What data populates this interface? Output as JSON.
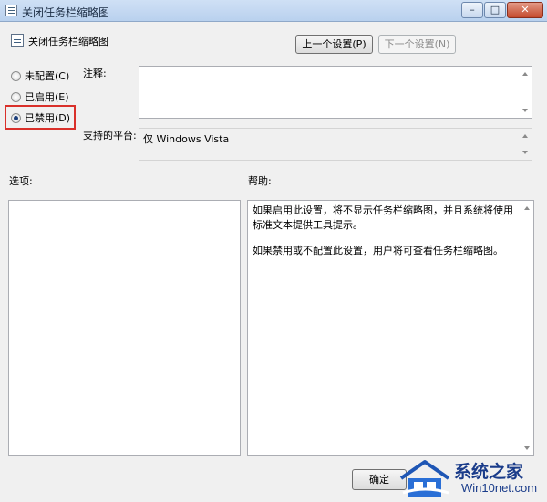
{
  "window": {
    "title": "关闭任务栏缩略图",
    "controls": {
      "minimize": "–",
      "maximize": "□",
      "close": "✕"
    }
  },
  "header": {
    "title": "关闭任务栏缩略图",
    "prev_label": "上一个设置(P)",
    "next_label": "下一个设置(N)"
  },
  "state": {
    "options": [
      {
        "label": "未配置(C)",
        "checked": false
      },
      {
        "label": "已启用(E)",
        "checked": false
      },
      {
        "label": "已禁用(D)",
        "checked": true
      }
    ],
    "highlight_color": "#d9302a"
  },
  "comment": {
    "label": "注释:",
    "value": ""
  },
  "platform": {
    "label": "支持的平台:",
    "value": "仅 Windows Vista"
  },
  "options_panel": {
    "label": "选项:"
  },
  "help": {
    "label": "帮助:",
    "paragraphs": [
      "如果启用此设置，将不显示任务栏缩略图，并且系统将使用标准文本提供工具提示。",
      "如果禁用或不配置此设置，用户将可查看任务栏缩略图。"
    ]
  },
  "footer": {
    "ok_label": "确定"
  },
  "watermark": {
    "cn": "系统之家",
    "en": "Win10net.com"
  }
}
